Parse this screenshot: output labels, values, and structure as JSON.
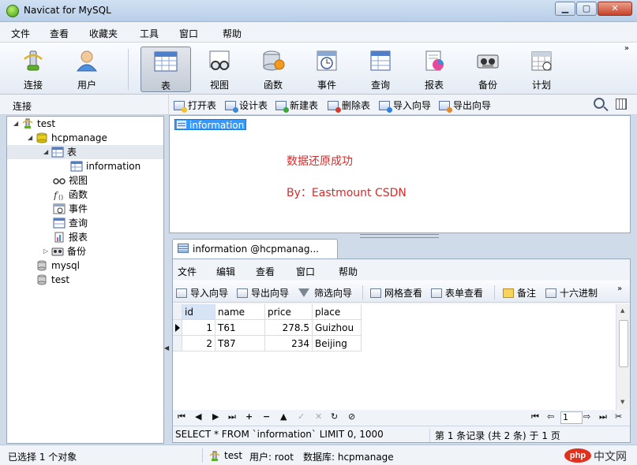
{
  "window": {
    "title": "Navicat for MySQL"
  },
  "menu": [
    "文件",
    "查看",
    "收藏夹",
    "工具",
    "窗口",
    "帮助"
  ],
  "toolbar": {
    "buttons": [
      {
        "label": "连接",
        "icon": "connection-icon"
      },
      {
        "label": "用户",
        "icon": "user-icon"
      },
      {
        "label": "表",
        "icon": "table-icon",
        "active": true
      },
      {
        "label": "视图",
        "icon": "view-icon"
      },
      {
        "label": "函数",
        "icon": "function-icon"
      },
      {
        "label": "事件",
        "icon": "event-icon"
      },
      {
        "label": "查询",
        "icon": "query-icon"
      },
      {
        "label": "报表",
        "icon": "report-icon"
      },
      {
        "label": "备份",
        "icon": "backup-icon"
      },
      {
        "label": "计划",
        "icon": "schedule-icon"
      }
    ],
    "more": "»"
  },
  "left_panel": {
    "header": "连接",
    "tree": [
      {
        "label": "test"
      },
      {
        "label": "hcpmanage"
      },
      {
        "label": "表"
      },
      {
        "label": "information"
      },
      {
        "label": "视图"
      },
      {
        "label": "函数"
      },
      {
        "label": "事件"
      },
      {
        "label": "查询"
      },
      {
        "label": "报表"
      },
      {
        "label": "备份"
      },
      {
        "label": "mysql"
      },
      {
        "label": "test"
      }
    ]
  },
  "object_toolbar": {
    "open": "打开表",
    "design": "设计表",
    "new": "新建表",
    "delete": "删除表",
    "import": "导入向导",
    "export": "导出向导"
  },
  "object_list": {
    "selected_item": "information",
    "message1": "数据还原成功",
    "message2": "By：Eastmount CSDN"
  },
  "tab": {
    "title": "information @hcpmanag...",
    "menu": [
      "文件",
      "编辑",
      "查看",
      "窗口",
      "帮助"
    ],
    "tools": {
      "import": "导入向导",
      "export": "导出向导",
      "filter": "筛选向导",
      "grid_view": "网格查看",
      "form_view": "表单查看",
      "memo": "备注",
      "hex": "十六进制"
    }
  },
  "grid": {
    "columns": [
      "id",
      "name",
      "price",
      "place"
    ],
    "rows": [
      [
        "1",
        "T61",
        "278.5",
        "Guizhou"
      ],
      [
        "2",
        "T87",
        "234",
        "Beijing"
      ]
    ]
  },
  "nav": {
    "page": "1"
  },
  "status": {
    "sql": "SELECT * FROM `information` LIMIT 0, 1000",
    "record": "第 1 条记录 (共 2 条) 于 1 页"
  },
  "statusbar": {
    "selected": "已选择 1 个对象",
    "db_label": "test",
    "user": "用户: root",
    "database": "数据库: hcpmanage",
    "logo_text": "中文网",
    "logo_badge": "php"
  }
}
